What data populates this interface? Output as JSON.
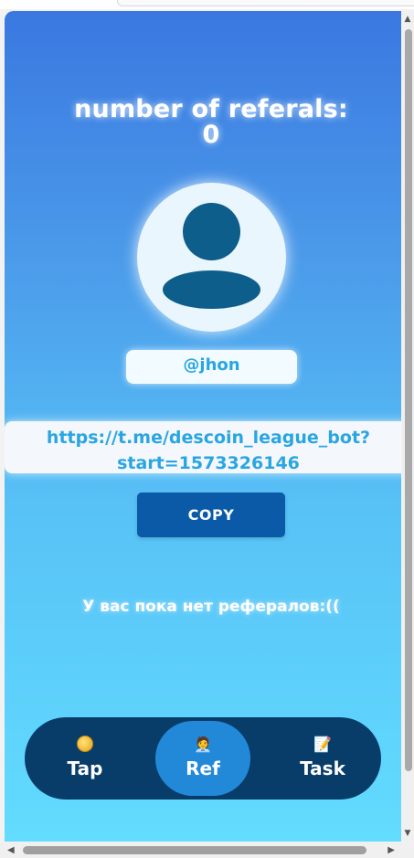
{
  "referrals": {
    "title": "number of referals:",
    "count": "0"
  },
  "profile": {
    "username": "@jhon"
  },
  "invite": {
    "link_line1": "https://t.me/descoin_league_bot?",
    "link_line2": "start=1573326146",
    "copy_label": "COPY"
  },
  "empty_state": {
    "message": "У вас пока нет рефералов:(("
  },
  "nav": {
    "items": [
      {
        "label": "Tap",
        "icon": "coin-icon",
        "active": false
      },
      {
        "label": "Ref",
        "icon": "person-icon",
        "active": true
      },
      {
        "label": "Task",
        "icon": "memo-icon",
        "active": false
      }
    ]
  },
  "colors": {
    "gradient_top": "#3a78e0",
    "gradient_bottom": "#62dcff",
    "accent_text": "#29a6e2",
    "copy_button": "#0a5aa8",
    "navbar": "#083d6a",
    "nav_active": "#2289d8",
    "avatar_fill": "#0d5e8a"
  }
}
